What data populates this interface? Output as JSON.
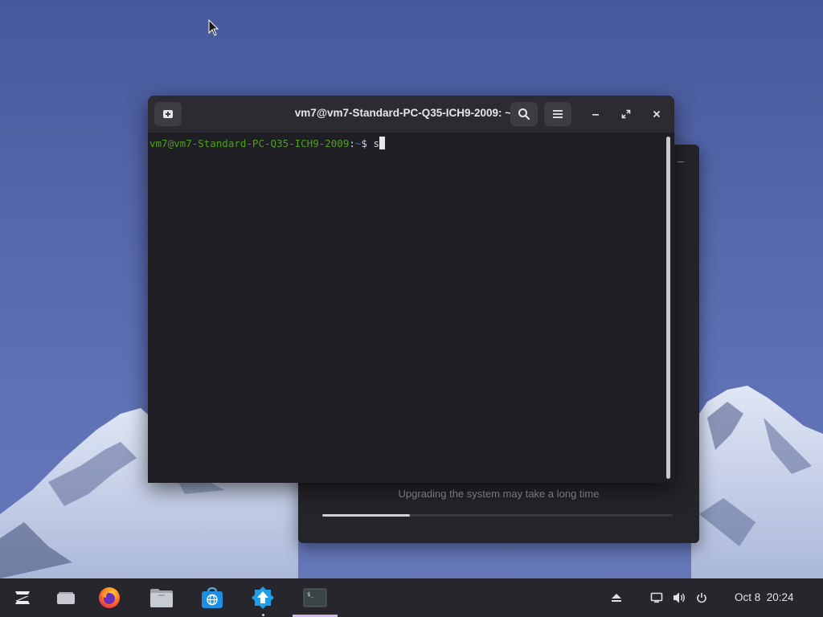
{
  "desktop": {
    "background": "mountain wallpaper",
    "cursor_icon": "arrow-cursor-icon"
  },
  "update_dialog": {
    "status_text": "Upgrading the system may take a long time",
    "progress": 0.25
  },
  "terminal": {
    "title": "vm7@vm7-Standard-PC-Q35-ICH9-2009: ~",
    "new_tab_icon": "new-tab-icon",
    "search_icon": "search-icon",
    "menu_icon": "hamburger-menu-icon",
    "minimize_icon": "minimize-icon",
    "maximize_icon": "maximize-icon",
    "close_icon": "close-icon",
    "prompt": {
      "user_host": "vm7@vm7-Standard-PC-Q35-ICH9-2009",
      "separator": ":",
      "path": "~",
      "dollar": "$ ",
      "command": "s"
    },
    "colors": {
      "user": "#4ea11a",
      "path": "#4a73c8",
      "background": "#1f1e24"
    }
  },
  "taskbar": {
    "items": [
      {
        "name": "zorin-menu",
        "icon": "zorin-logo-icon"
      },
      {
        "name": "workspaces",
        "icon": "workspaces-icon"
      },
      {
        "name": "firefox",
        "icon": "firefox-icon"
      },
      {
        "name": "files",
        "icon": "folder-icon"
      },
      {
        "name": "software",
        "icon": "software-store-icon"
      },
      {
        "name": "software-updater",
        "icon": "update-arrow-icon"
      },
      {
        "name": "terminal",
        "icon": "terminal-icon"
      }
    ],
    "tray": {
      "eject_icon": "eject-icon",
      "screen_icon": "display-icon",
      "volume_icon": "volume-icon",
      "power_icon": "power-icon"
    },
    "date": "Oct 8",
    "time": "20:24"
  }
}
